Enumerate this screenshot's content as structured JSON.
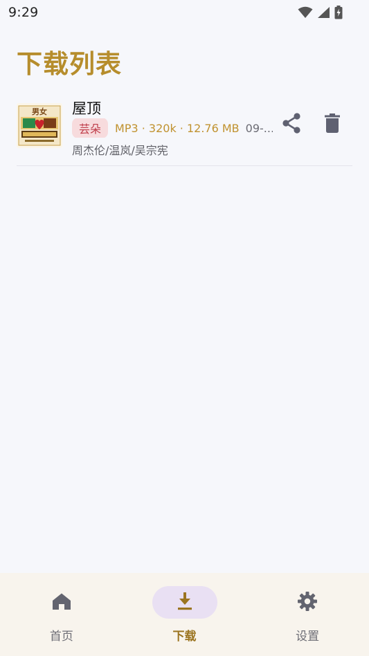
{
  "status_bar": {
    "time": "9:29",
    "icons": [
      "wifi-icon",
      "cell-signal-icon",
      "battery-charging-icon"
    ]
  },
  "page": {
    "title": "下载列表"
  },
  "downloads": [
    {
      "title": "屋顶",
      "source": "芸朵",
      "info": "MP3 · 320k · 12.76 MB",
      "date": "09-...",
      "artist": "周杰伦/温岚/吴宗宪",
      "cover_icon": "album-cover",
      "cover_text": "男女"
    }
  ],
  "actions": {
    "share_icon": "share-icon",
    "delete_icon": "trash-icon"
  },
  "bottom_nav": {
    "items": [
      {
        "label": "首页",
        "icon": "home-icon",
        "active": false
      },
      {
        "label": "下载",
        "icon": "download-icon",
        "active": true
      },
      {
        "label": "设置",
        "icon": "gear-icon",
        "active": false
      }
    ]
  },
  "colors": {
    "accent": "#b68d2c",
    "badge_bg": "#f7dbdd",
    "badge_text": "#bf3d4a",
    "active_nav_bg": "#e9e0f3",
    "background": "#f6f7fb",
    "nav_bg": "#f8f4ed"
  }
}
